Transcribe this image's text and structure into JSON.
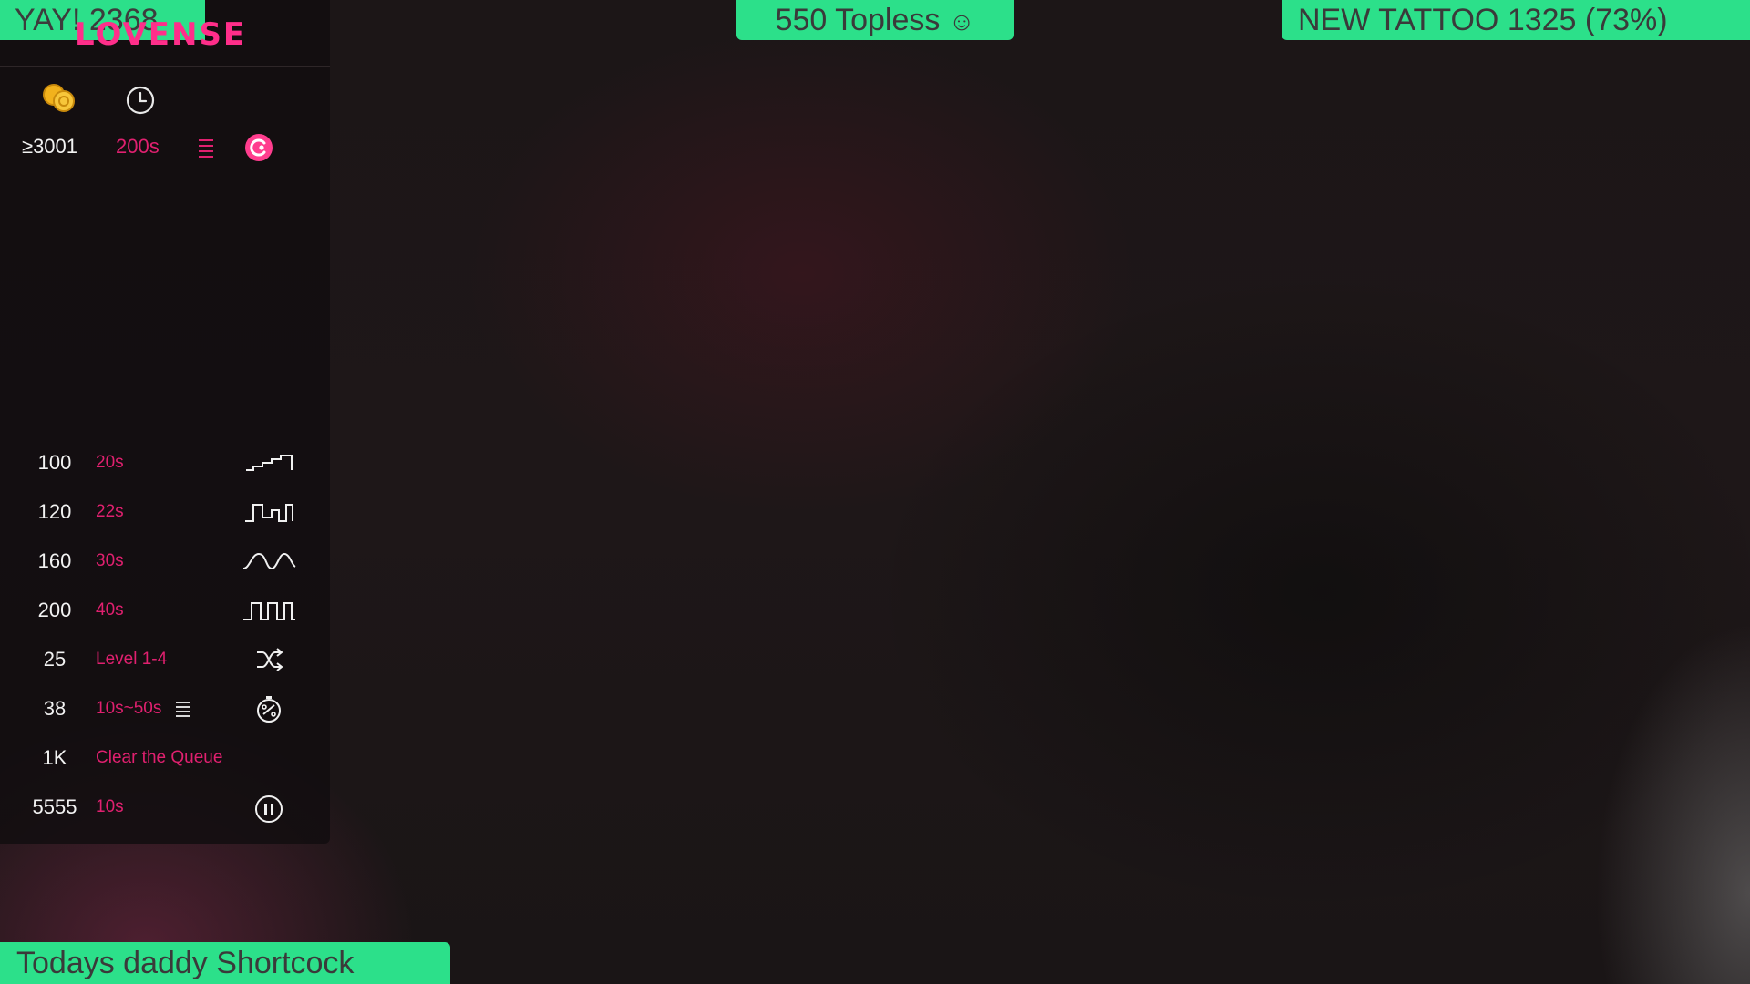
{
  "overlay": {
    "top_left_banner": "YAY! 2368",
    "top_center_banner": "550 Topless",
    "top_center_emoji": "☺",
    "top_right_banner": "NEW TATTOO 1325 (73%)",
    "bottom_banner": "Todays daddy Shortcock"
  },
  "panel": {
    "logo": "LOVENSE",
    "special": {
      "amount": "≥3001",
      "duration": "200s"
    },
    "rows": [
      {
        "amount": "100",
        "detail": "20s",
        "icon": "stairs-wave-icon"
      },
      {
        "amount": "120",
        "detail": "22s",
        "icon": "pulse-step-icon"
      },
      {
        "amount": "160",
        "detail": "30s",
        "icon": "wave-icon"
      },
      {
        "amount": "200",
        "detail": "40s",
        "icon": "square-wave-icon"
      },
      {
        "amount": "25",
        "detail": "Level 1-4",
        "icon": "shuffle-icon"
      },
      {
        "amount": "38",
        "detail": "10s~50s",
        "icon": "random-timer-icon"
      },
      {
        "amount": "1K",
        "detail": "Clear the Queue",
        "icon": ""
      },
      {
        "amount": "5555",
        "detail": "10s",
        "icon": "pause-icon"
      }
    ]
  },
  "colors": {
    "banner": "#2ce08a",
    "accent": "#e0206f",
    "logo": "#ff2e8a"
  }
}
